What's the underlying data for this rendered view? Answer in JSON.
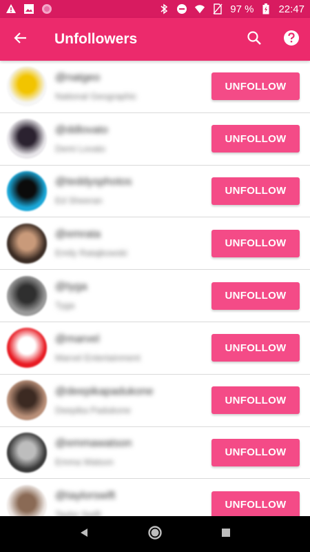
{
  "status_bar": {
    "battery": "97 %",
    "time": "22:47",
    "icons": [
      "warning-icon",
      "image-icon",
      "circle-app-icon",
      "bluetooth-icon",
      "do-not-disturb-icon",
      "wifi-icon",
      "no-sim-icon",
      "battery-icon"
    ]
  },
  "app_bar": {
    "title": "Unfollowers",
    "icons": [
      "back-arrow-icon",
      "search-icon",
      "help-icon"
    ]
  },
  "list": {
    "button_label": "UNFOLLOW",
    "items": [
      {
        "handle": "@natgeo",
        "name": "National Geographic",
        "avatar_color": "#f5f5f5",
        "avatar_accent": "#f2c400"
      },
      {
        "handle": "@ddlovato",
        "name": "Demi Lovato",
        "avatar_color": "#e8e6ea",
        "avatar_accent": "#2b2230"
      },
      {
        "handle": "@teddysphotos",
        "name": "Ed Sheeran",
        "avatar_color": "#1aa7d8",
        "avatar_accent": "#0b0b0b"
      },
      {
        "handle": "@emrata",
        "name": "Emily Ratajkowski",
        "avatar_color": "#3b2c24",
        "avatar_accent": "#c99a7a"
      },
      {
        "handle": "@tyga",
        "name": "Tyga",
        "avatar_color": "#9a9a9a",
        "avatar_accent": "#2f2f2f"
      },
      {
        "handle": "@marvel",
        "name": "Marvel Entertainment",
        "avatar_color": "#e81b23",
        "avatar_accent": "#ffffff"
      },
      {
        "handle": "@deepikapadukone",
        "name": "Deepika Padukone",
        "avatar_color": "#b98f78",
        "avatar_accent": "#3c2a22"
      },
      {
        "handle": "@emmawatson",
        "name": "Emma Watson",
        "avatar_color": "#3a3a3a",
        "avatar_accent": "#bdbdbd"
      },
      {
        "handle": "@taylorswift",
        "name": "Taylor Swift",
        "avatar_color": "#efe9e6",
        "avatar_accent": "#8a6a55"
      }
    ]
  },
  "nav_bar": {
    "icons": [
      "back-triangle-icon",
      "home-circle-icon",
      "recents-square-icon"
    ]
  }
}
